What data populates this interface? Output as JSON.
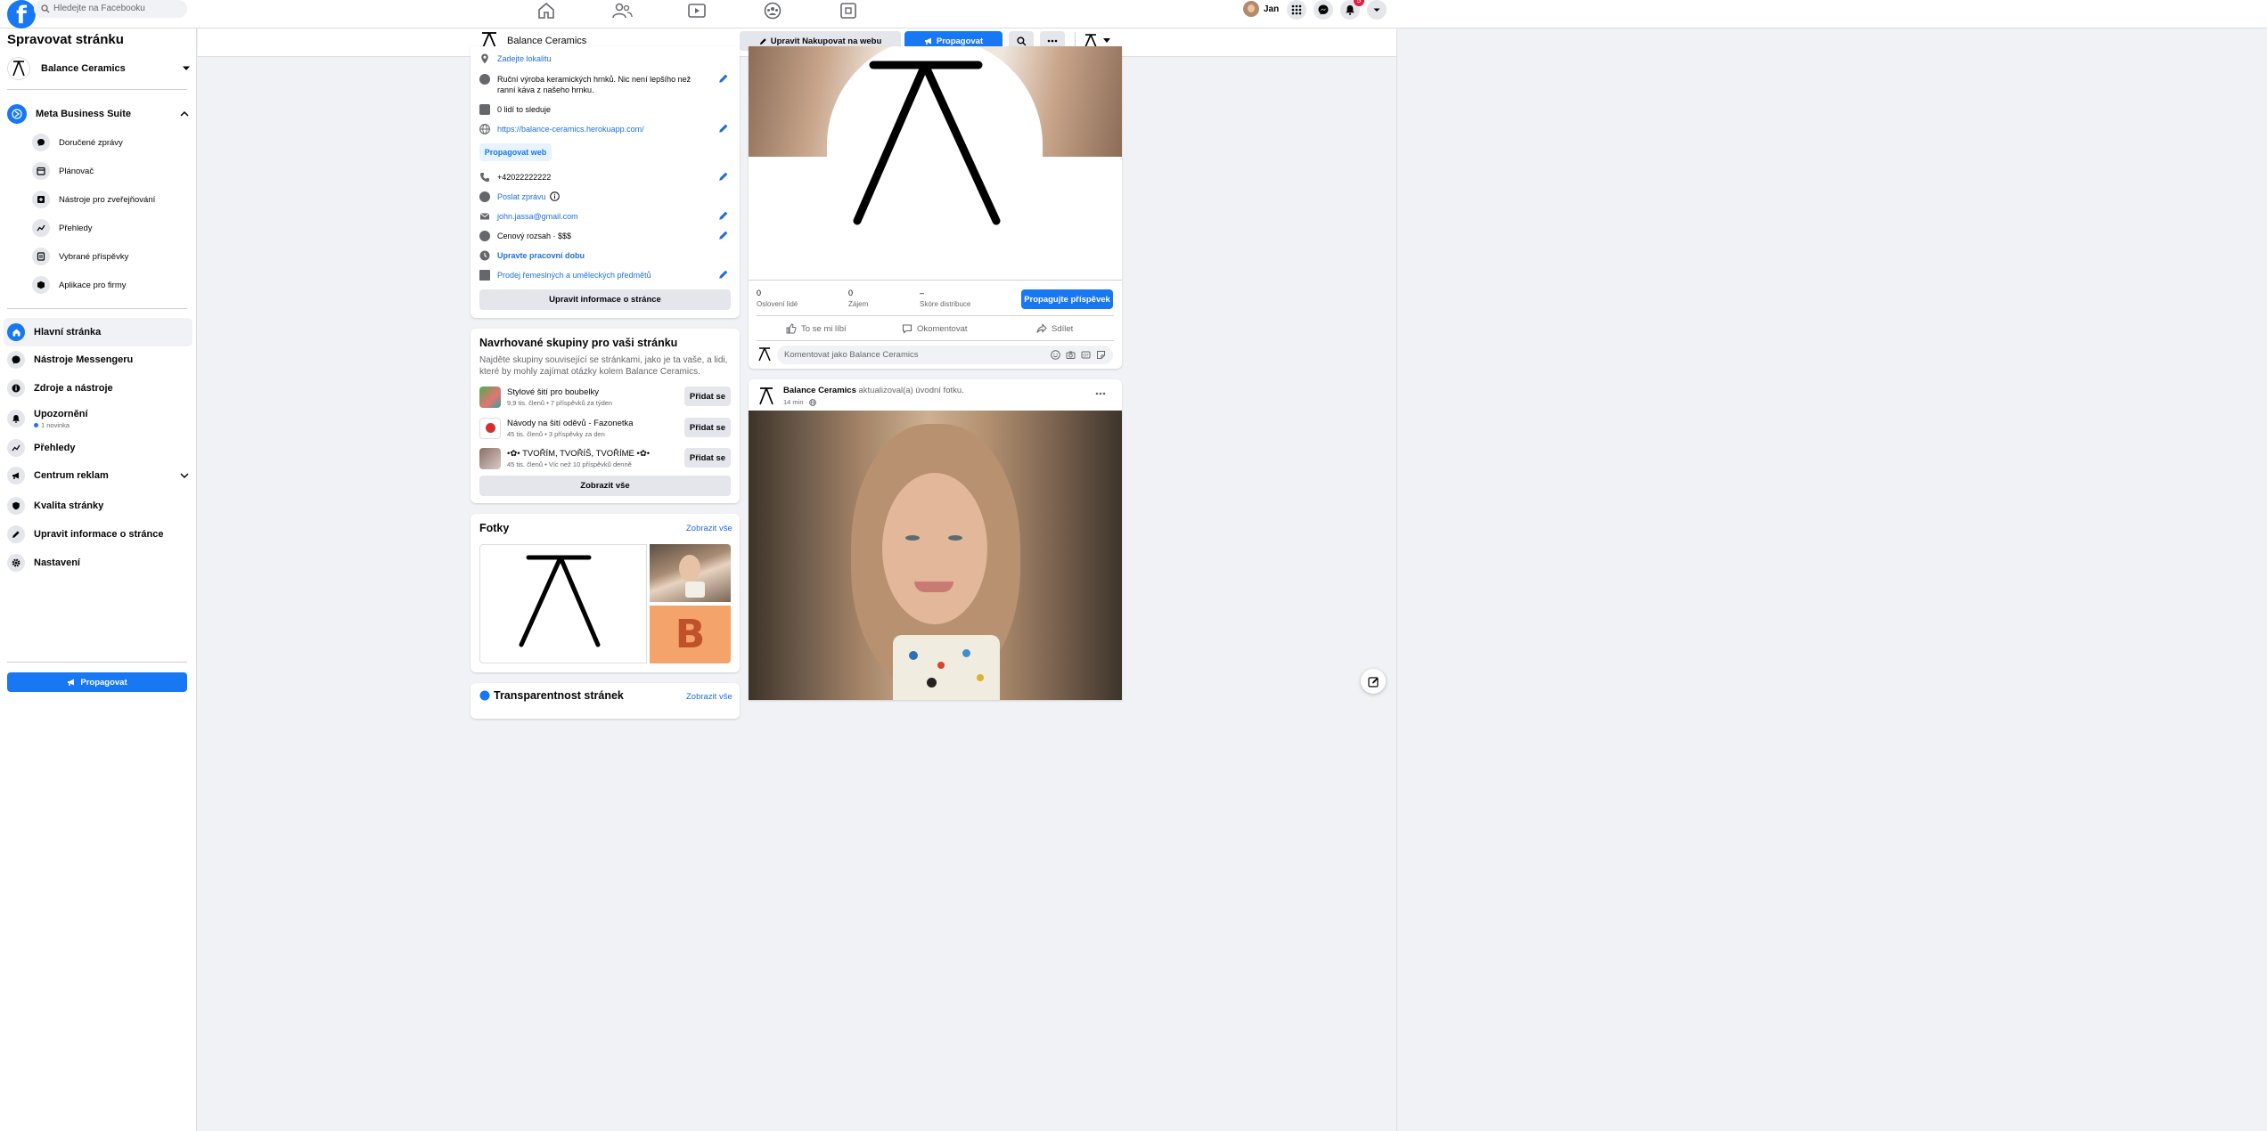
{
  "topnav": {
    "search_placeholder": "Hledejte na Facebooku",
    "user_name": "Jan",
    "notification_count": "5"
  },
  "sidebar": {
    "title": "Spravovat stránku",
    "page_name": "Balance Ceramics",
    "business_suite": "Meta Business Suite",
    "suite_items": [
      {
        "label": "Doručené zprávy",
        "icon": "chat-bubble-icon"
      },
      {
        "label": "Plánovač",
        "icon": "calendar-icon"
      },
      {
        "label": "Nástroje pro zveřejňování",
        "icon": "publishing-tools-icon"
      },
      {
        "label": "Přehledy",
        "icon": "insights-icon"
      },
      {
        "label": "Vybrané příspěvky",
        "icon": "featured-posts-icon"
      },
      {
        "label": "Aplikace pro firmy",
        "icon": "box-icon"
      }
    ],
    "main_items": [
      {
        "label": "Hlavní stránka",
        "icon": "home-icon"
      },
      {
        "label": "Nástroje Messengeru",
        "icon": "messenger-icon"
      },
      {
        "label": "Zdroje a nástroje",
        "icon": "info-icon"
      },
      {
        "label": "Upozornění",
        "sub": "1 novinka",
        "icon": "bell-icon"
      },
      {
        "label": "Přehledy",
        "icon": "insights-icon"
      },
      {
        "label": "Centrum reklam",
        "icon": "megaphone-icon"
      },
      {
        "label": "Kvalita stránky",
        "icon": "shield-icon"
      },
      {
        "label": "Upravit informace o stránce",
        "icon": "pencil-icon"
      },
      {
        "label": "Nastavení",
        "icon": "gear-icon"
      }
    ],
    "promote_label": "Propagovat"
  },
  "pageheader": {
    "page_name": "Balance Ceramics",
    "edit_shop_label": "Upravit Nakupovat na webu",
    "promote_label": "Propagovat"
  },
  "about": {
    "location_link": "Zadejte lokalitu",
    "description": "Ruční výroba keramických hrnků. Nic není lepšího než ranní káva z našeho hrnku.",
    "followers": "0 lidí to sleduje",
    "website": "https://balance-ceramics.herokuapp.com/",
    "promote_web": "Propagovat web",
    "phone": "+42022222222",
    "send_message": "Poslat zprávu",
    "email": "john.jassa@gmail.com",
    "price": "Cenový rozsah · $$$",
    "hours": "Upravte pracovní dobu",
    "category": "Prodej řemeslných a uměleckých předmětů",
    "edit_button": "Upravit informace o stránce"
  },
  "groups": {
    "title": "Navrhované skupiny pro vaši stránku",
    "desc": "Najděte skupiny související se stránkami, jako je ta vaše, a lidi, které by mohly zajímat otázky kolem Balance Ceramics.",
    "items": [
      {
        "name": "Stylové šití pro boubelky",
        "meta": "9,9 tis. členů • 7 příspěvků za týden",
        "btn": "Přidat se"
      },
      {
        "name": "Návody na šití oděvů - Fazonetka",
        "meta": "45 tis. členů • 3 příspěvky za den",
        "btn": "Přidat se"
      },
      {
        "name": "•✿• TVOŘÍM, TVOŘÍŠ, TVOŘÍME •✿•",
        "meta": "45 tis. členů • Víc než 10 příspěvků denně",
        "btn": "Přidat se"
      }
    ],
    "show_all": "Zobrazit vše"
  },
  "photos": {
    "title": "Fotky",
    "show_all": "Zobrazit vše",
    "tile_letter": "B"
  },
  "transparency": {
    "title": "Transparentnost stránek",
    "show_all": "Zobrazit vše"
  },
  "post1": {
    "stats": [
      {
        "value": "0",
        "label": "Oslovení lidé"
      },
      {
        "value": "0",
        "label": "Zájem"
      },
      {
        "value": "–",
        "label": "Skóre distribuce"
      }
    ],
    "promote_post": "Propagujte příspěvek",
    "like": "To se mi líbí",
    "comment": "Okomentovat",
    "share": "Sdílet",
    "comment_placeholder": "Komentovat jako Balance Ceramics"
  },
  "post2": {
    "author": "Balance Ceramics",
    "action": "aktualizoval(a) úvodní fotku.",
    "time": "14 min ·"
  },
  "colors": {
    "accent": "#1877f2",
    "link": "#216fdb",
    "bg": "#f0f2f5"
  }
}
